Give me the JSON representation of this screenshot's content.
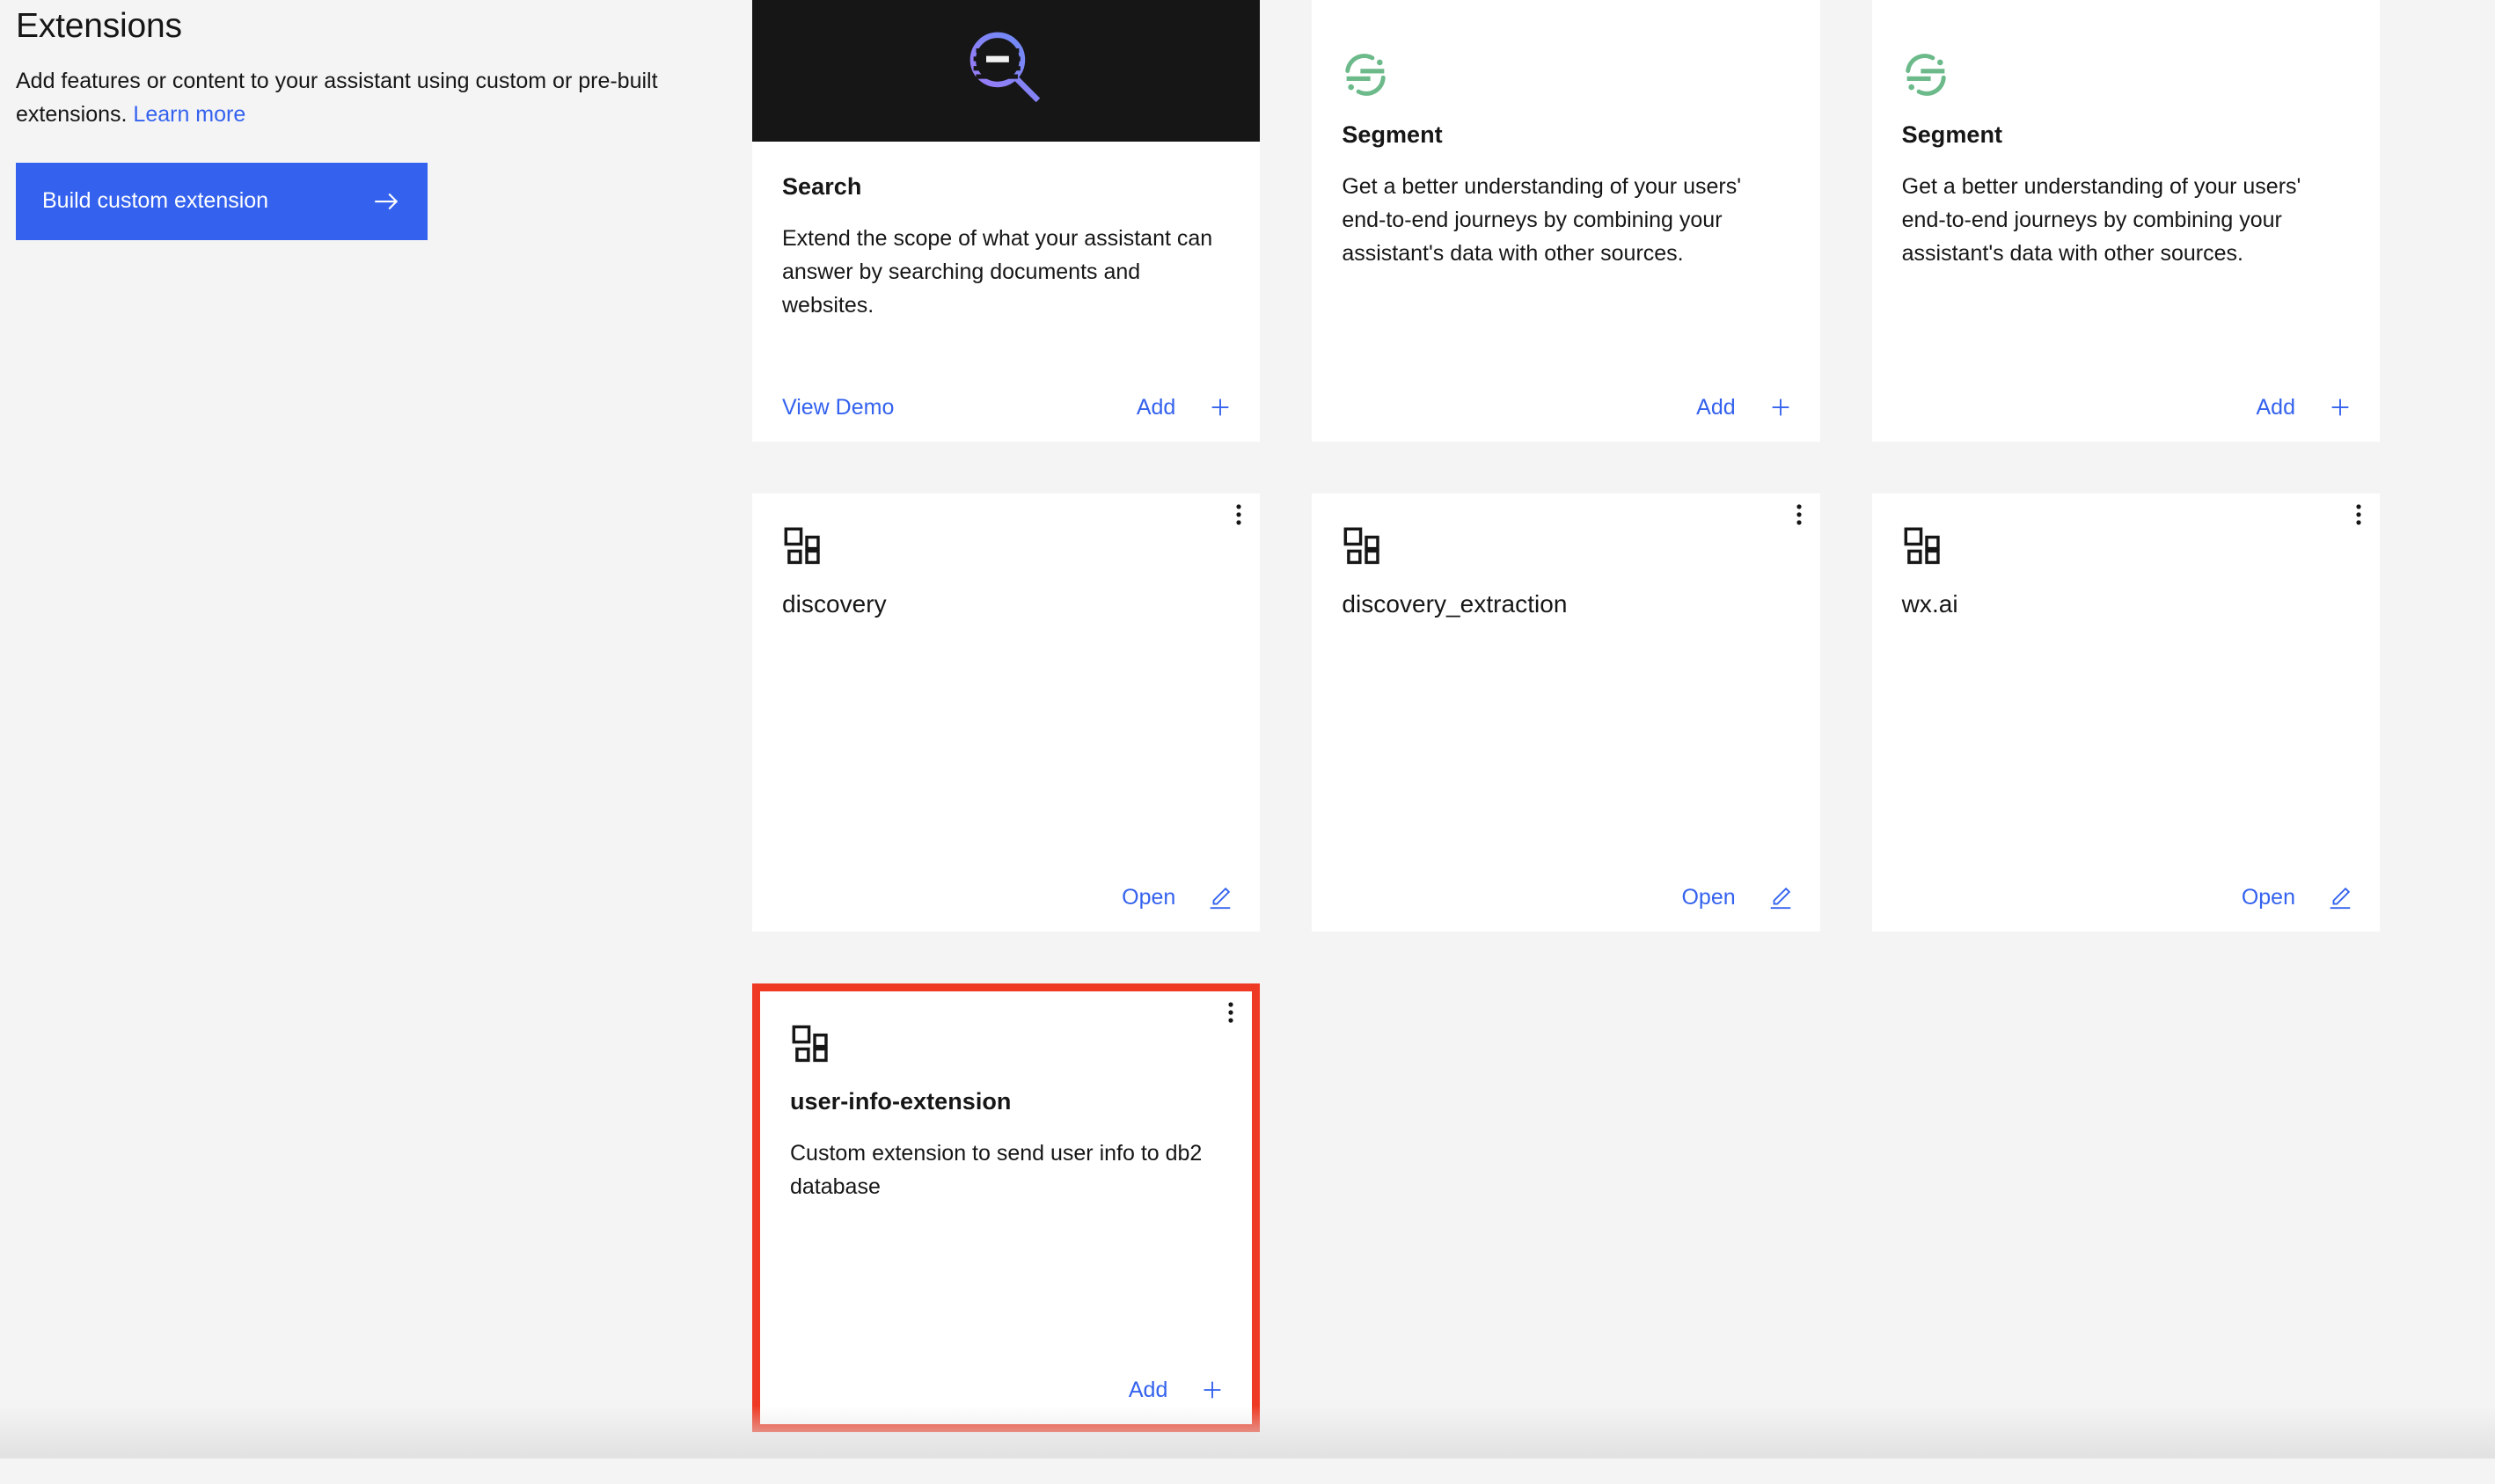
{
  "page": {
    "title": "Extensions",
    "description_before_link": "Add features or content to your assistant using custom or pre-built extensions. ",
    "learn_more_label": "Learn more",
    "build_button_label": "Build custom extension",
    "accent_blue": "#3462ee",
    "highlight_red": "#ee3a24",
    "media_black": "#161616",
    "segment_green": "#6cb98a",
    "page_background": "#f4f4f4"
  },
  "cards": [
    {
      "id": "search",
      "kind": "prebuilt",
      "has_media": true,
      "media_icon": "search-magnifier-icon",
      "icon": "",
      "title": "Search",
      "description": "Extend the scope of what your assistant can answer by searching documents and websites.",
      "footer_left_label": "View Demo",
      "footer_action_label": "Add",
      "footer_action_icon": "plus-icon"
    },
    {
      "id": "segment-1",
      "kind": "prebuilt",
      "has_media": false,
      "media_icon": "",
      "icon": "segment-logo-icon",
      "title": "Segment",
      "description": "Get a better understanding of your users' end-to-end journeys by combining your assistant's data with other sources.",
      "footer_left_label": "",
      "footer_action_label": "Add",
      "footer_action_icon": "plus-icon"
    },
    {
      "id": "segment-2",
      "kind": "prebuilt",
      "has_media": false,
      "media_icon": "",
      "icon": "segment-logo-icon",
      "title": "Segment",
      "description": "Get a better understanding of your users' end-to-end journeys by combining your assistant's data with other sources.",
      "footer_left_label": "",
      "footer_action_label": "Add",
      "footer_action_icon": "plus-icon"
    },
    {
      "id": "discovery",
      "kind": "custom",
      "has_media": false,
      "media_icon": "",
      "icon": "application-tile-icon",
      "title": "discovery",
      "description": "",
      "overflow_icon": "overflow-menu-vertical-icon",
      "footer_left_label": "",
      "footer_action_label": "Open",
      "footer_action_icon": "edit-pencil-icon"
    },
    {
      "id": "discovery_extraction",
      "kind": "custom",
      "has_media": false,
      "media_icon": "",
      "icon": "application-tile-icon",
      "title": "discovery_extraction",
      "description": "",
      "overflow_icon": "overflow-menu-vertical-icon",
      "footer_left_label": "",
      "footer_action_label": "Open",
      "footer_action_icon": "edit-pencil-icon"
    },
    {
      "id": "wx-ai",
      "kind": "custom",
      "has_media": false,
      "media_icon": "",
      "icon": "application-tile-icon",
      "title": "wx.ai",
      "description": "",
      "overflow_icon": "overflow-menu-vertical-icon",
      "footer_left_label": "",
      "footer_action_label": "Open",
      "footer_action_icon": "edit-pencil-icon"
    },
    {
      "id": "user-info-extension",
      "kind": "custom",
      "highlighted": true,
      "has_media": false,
      "media_icon": "",
      "icon": "application-tile-icon",
      "title": "user-info-extension",
      "description": "Custom extension to send user info to db2 database",
      "overflow_icon": "overflow-menu-vertical-icon",
      "footer_left_label": "",
      "footer_action_label": "Add",
      "footer_action_icon": "plus-icon"
    }
  ]
}
